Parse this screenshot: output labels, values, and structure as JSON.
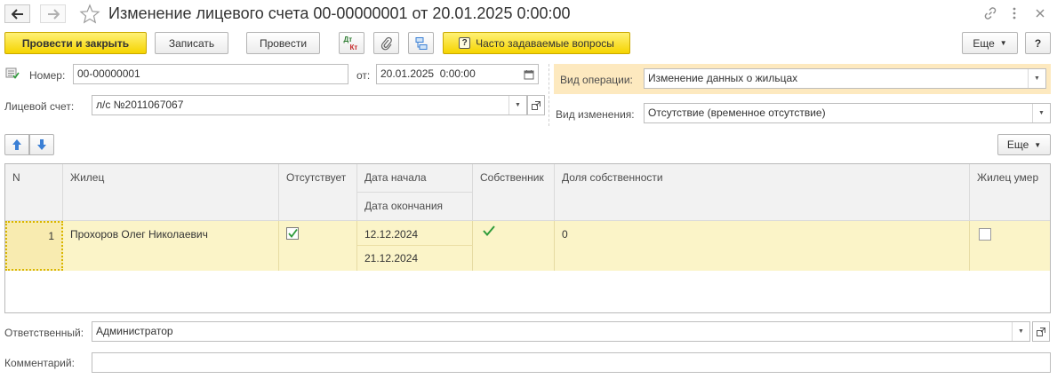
{
  "window": {
    "title": "Изменение лицевого счета 00-00000001 от 20.01.2025 0:00:00"
  },
  "toolbar": {
    "post_and_close": "Провести и закрыть",
    "write": "Записать",
    "post": "Провести",
    "dt_kt_top": "Дт",
    "dt_kt_bottom": "Кт",
    "faq": "Часто задаваемые вопросы",
    "more": "Еще",
    "help": "?"
  },
  "form": {
    "number_label": "Номер:",
    "number_value": "00-00000001",
    "date_label": "от:",
    "date_value": "20.01.2025  0:00:00",
    "account_label": "Лицевой счет:",
    "account_value": "л/с №2011067067",
    "operation_label": "Вид операции:",
    "operation_value": "Изменение данных о жильцах",
    "change_label": "Вид изменения:",
    "change_value": "Отсутствие (временное отсутствие)"
  },
  "table_toolbar": {
    "more": "Еще"
  },
  "table": {
    "headers": {
      "n": "N",
      "resident": "Жилец",
      "absent": "Отсутствует",
      "start_date": "Дата начала",
      "end_date": "Дата окончания",
      "owner": "Собственник",
      "share": "Доля собственности",
      "deceased": "Жилец умер"
    },
    "rows": [
      {
        "n": "1",
        "resident": "Прохоров Олег Николаевич",
        "absent": true,
        "start_date": "12.12.2024",
        "end_date": "21.12.2024",
        "owner": true,
        "share": "0",
        "deceased": false
      }
    ]
  },
  "footer": {
    "responsible_label": "Ответственный:",
    "responsible_value": "Администратор",
    "comment_label": "Комментарий:",
    "comment_value": ""
  },
  "colors": {
    "accent_yellow": "#f5d400",
    "row_highlight": "#fbf4c8",
    "operation_highlight": "#fde9bf",
    "check_green": "#2e9b3a",
    "arrow_blue": "#3a7fd5"
  },
  "icons": {
    "back": "arrow-left-icon",
    "forward": "arrow-right-icon",
    "favorite": "star-icon",
    "link": "link-icon",
    "menu": "more-vertical-icon",
    "close": "close-icon",
    "attach": "paperclip-icon",
    "structure": "structure-icon",
    "calendar": "calendar-icon",
    "open": "open-form-icon",
    "move_up": "arrow-up-icon",
    "move_down": "arrow-down-icon"
  }
}
